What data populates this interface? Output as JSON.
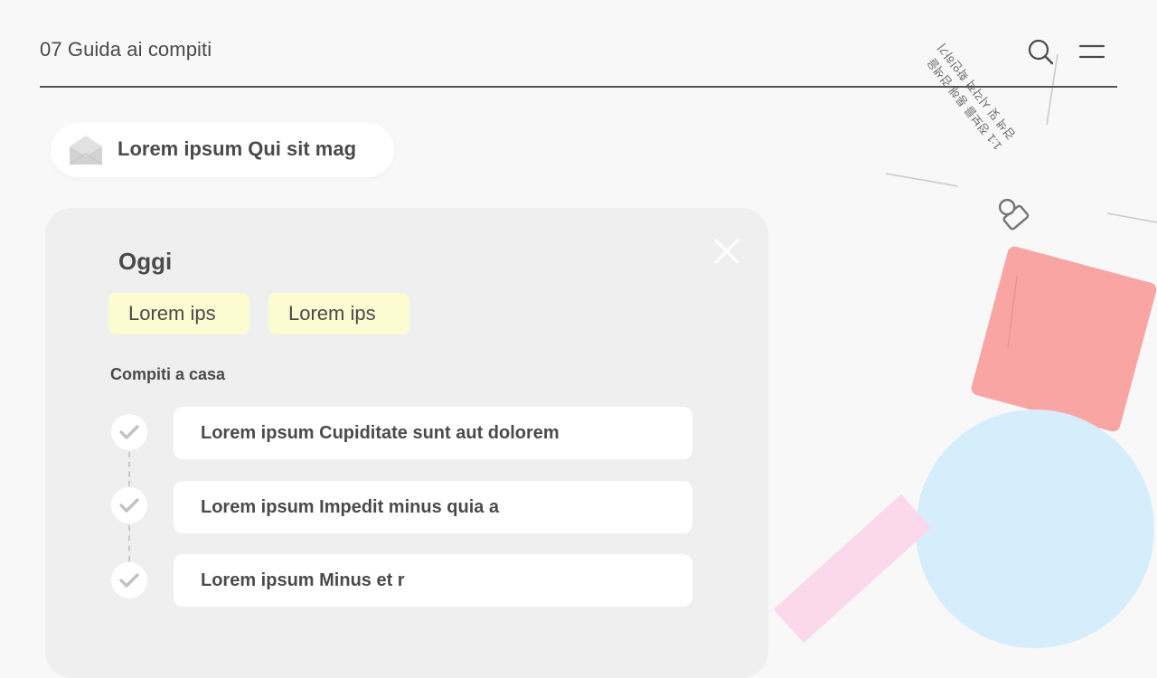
{
  "header": {
    "title": "07 Guida ai compiti",
    "search_icon": "search-icon",
    "menu_icon": "menu-icon"
  },
  "pill": {
    "icon": "envelope-open-icon",
    "label": "Lorem ipsum Qui sit mag"
  },
  "card": {
    "heading": "Oggi",
    "close_icon": "close-icon",
    "tags": [
      "Lorem ips",
      "Lorem ips"
    ],
    "section_label": "Compiti a casa",
    "tasks": [
      "Lorem ipsum Cupiditate sunt aut dolorem",
      "Lorem ipsum Impedit minus quia a",
      "Lorem ipsum Minus et r"
    ]
  },
  "decoration": {
    "rotated_text": [
      "1:1 정보를 통해 검색을",
      "검색 및 시각적 확인하기"
    ],
    "user_icon": "user-outline-icon"
  },
  "colors": {
    "background": "#f8f8f9",
    "card": "#efeff0",
    "tag": "#fdfbd2",
    "red_square": "#f9a5a4",
    "blue_circle": "#d6eefc",
    "pink_bar": "#fcd8ec",
    "text": "#4a4a4a"
  }
}
